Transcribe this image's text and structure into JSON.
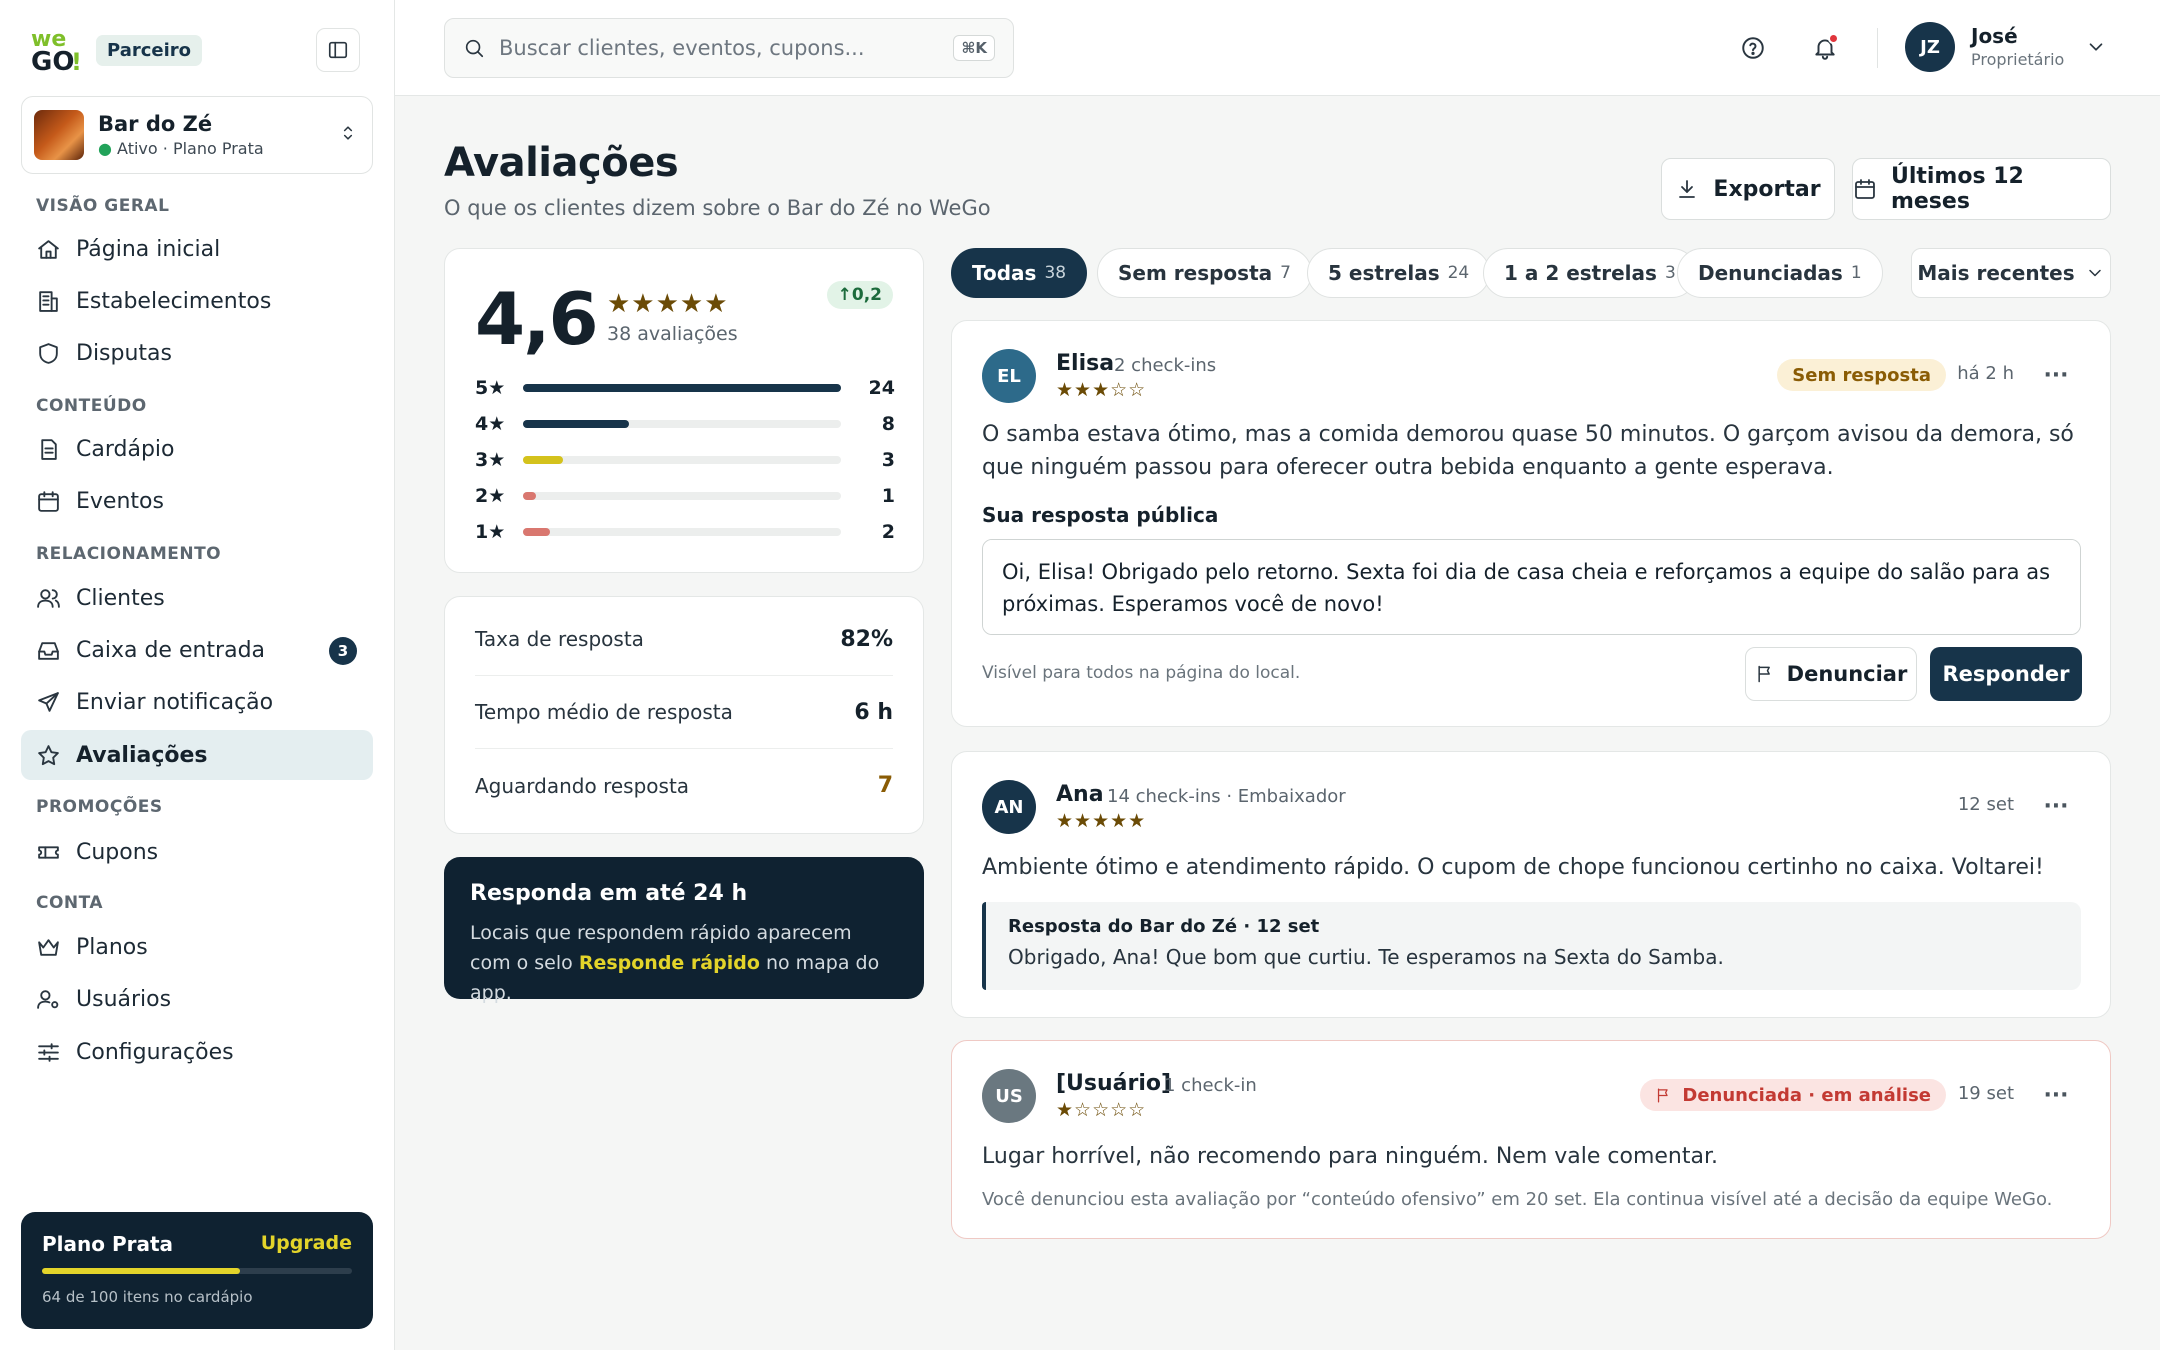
{
  "brand": {
    "logo_text": "weGO!",
    "partner_badge": "Parceiro",
    "colors": {
      "primary": "#17344a",
      "dark": "#0f2231",
      "accent_yellow": "#e3d42a",
      "logo_green": "#7fbf2a"
    }
  },
  "venue": {
    "name": "Bar do Zé",
    "status": "Ativo · Plano Prata"
  },
  "sidebar": {
    "sections": [
      {
        "title": "VISÃO GERAL",
        "items": [
          {
            "label": "Página inicial",
            "icon": "home-icon"
          },
          {
            "label": "Estabelecimentos",
            "icon": "building-icon"
          },
          {
            "label": "Disputas",
            "icon": "shield-icon"
          }
        ]
      },
      {
        "title": "CONTEÚDO",
        "items": [
          {
            "label": "Cardápio",
            "icon": "document-icon"
          },
          {
            "label": "Eventos",
            "icon": "calendar-icon"
          }
        ]
      },
      {
        "title": "RELACIONAMENTO",
        "items": [
          {
            "label": "Clientes",
            "icon": "users-icon"
          },
          {
            "label": "Caixa de entrada",
            "icon": "inbox-icon",
            "count": "3"
          },
          {
            "label": "Enviar notificação",
            "icon": "send-icon"
          },
          {
            "label": "Avaliações",
            "icon": "star-icon",
            "active": true
          }
        ]
      },
      {
        "title": "PROMOÇÕES",
        "items": [
          {
            "label": "Cupons",
            "icon": "ticket-icon"
          }
        ]
      },
      {
        "title": "CONTA",
        "items": [
          {
            "label": "Planos",
            "icon": "crown-icon"
          },
          {
            "label": "Usuários",
            "icon": "user-settings-icon"
          },
          {
            "label": "Configurações",
            "icon": "sliders-icon"
          }
        ]
      }
    ],
    "plan": {
      "name": "Plano Prata",
      "upgrade_label": "Upgrade",
      "usage_text": "64 de 100 itens no cardápio",
      "usage_fraction": 0.64
    }
  },
  "topbar": {
    "search_placeholder": "Buscar clientes, eventos, cupons...",
    "shortcut": "⌘K",
    "user": {
      "initials": "JZ",
      "name": "José",
      "role": "Proprietário"
    }
  },
  "page": {
    "title": "Avaliações",
    "subtitle": "O que os clientes dizem sobre o Bar do Zé no WeGo",
    "export_label": "Exportar",
    "period_label": "Últimos 12 meses"
  },
  "summary": {
    "score": "4,6",
    "stars": "★★★★★",
    "count_text": "38 avaliações",
    "trend": "0,2",
    "distribution": [
      {
        "label": "5★",
        "count": 24,
        "color": "#17344a"
      },
      {
        "label": "4★",
        "count": 8,
        "color": "#17344a"
      },
      {
        "label": "3★",
        "count": 3,
        "color": "#d4c21c"
      },
      {
        "label": "2★",
        "count": 1,
        "color": "#d9776f"
      },
      {
        "label": "1★",
        "count": 2,
        "color": "#d9776f"
      }
    ]
  },
  "stats": [
    {
      "label": "Taxa de resposta",
      "value": "82%",
      "warn": false
    },
    {
      "label": "Tempo médio de resposta",
      "value": "6 h",
      "warn": false
    },
    {
      "label": "Aguardando resposta",
      "value": "7",
      "warn": true
    }
  ],
  "tip": {
    "title": "Responda em até 24 h",
    "text_before": "Locais que respondem rápido aparecem com o selo ",
    "highlight": "Responde rápido",
    "text_after": " no mapa do app."
  },
  "filters": [
    {
      "label": "Todas",
      "count": "38",
      "active": true
    },
    {
      "label": "Sem resposta",
      "count": "7",
      "active": false
    },
    {
      "label": "5 estrelas",
      "count": "24",
      "active": false
    },
    {
      "label": "1 a 2 estrelas",
      "count": "3",
      "active": false
    },
    {
      "label": "Denunciadas",
      "count": "1",
      "active": false
    }
  ],
  "sort_label": "Mais recentes",
  "reviews": [
    {
      "initials": "EL",
      "avatar_color": "#2d6a8a",
      "name": "Elisa",
      "meta": "2 check-ins",
      "stars": "★★★☆☆",
      "tag": "Sem resposta",
      "date": "há 2 h",
      "text": "O samba estava ótimo, mas a comida demorou quase 50 minutos. O garçom avisou da demora, só que ninguém passou para oferecer outra bebida enquanto a gente esperava.",
      "reply_label": "Sua resposta pública",
      "reply_draft": "Oi, Elisa! Obrigado pelo retorno. Sexta foi dia de casa cheia e reforçamos a equipe do salão para as próximas. Esperamos você de novo!",
      "hint": "Visível para todos na página do local.",
      "flag_label": "Denunciar",
      "reply_button": "Responder"
    },
    {
      "initials": "AN",
      "avatar_color": "#17344a",
      "name": "Ana",
      "meta": "14 check-ins · Embaixador",
      "stars": "★★★★★",
      "date": "12 set",
      "text": "Ambiente ótimo e atendimento rápido. O cupom de chope funcionou certinho no caixa. Voltarei!",
      "reply_title": "Resposta do Bar do Zé · 12 set",
      "reply_text": "Obrigado, Ana! Que bom que curtiu. Te esperamos na Sexta do Samba."
    },
    {
      "initials": "US",
      "avatar_color": "#6a7880",
      "name": "[Usuário]",
      "meta": "1 check-in",
      "stars": "★☆☆☆☆",
      "tag": "Denunciada · em análise",
      "date": "19 set",
      "text": "Lugar horrível, não recomendo para ninguém. Nem vale comentar.",
      "note": "Você denunciou esta avaliação por “conteúdo ofensivo” em 20 set. Ela continua visível até a decisão da equipe WeGo."
    }
  ]
}
